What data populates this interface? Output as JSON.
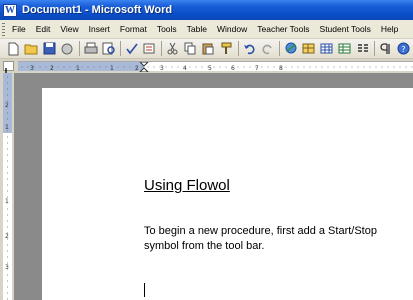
{
  "window": {
    "title": "Document1 - Microsoft Word",
    "app_icon": "W"
  },
  "menubar": {
    "items": [
      {
        "label": "File"
      },
      {
        "label": "Edit"
      },
      {
        "label": "View"
      },
      {
        "label": "Insert"
      },
      {
        "label": "Format"
      },
      {
        "label": "Tools"
      },
      {
        "label": "Table"
      },
      {
        "label": "Window"
      },
      {
        "label": "Teacher Tools"
      },
      {
        "label": "Student Tools"
      },
      {
        "label": "Help"
      }
    ]
  },
  "toolbar": {
    "icons": [
      "new-document-icon",
      "open-folder-icon",
      "save-icon",
      "permission-icon",
      "print-icon",
      "print-preview-icon",
      "spelling-icon",
      "research-icon",
      "cut-icon",
      "copy-icon",
      "paste-icon",
      "format-painter-icon",
      "undo-icon",
      "redo-icon",
      "hyperlink-icon",
      "tables-borders-icon",
      "insert-table-icon",
      "insert-excel-icon",
      "columns-icon",
      "show-hide-icon",
      "help-icon"
    ]
  },
  "ruler": {
    "horizontal_numbers": [
      "3",
      "2",
      "1",
      "1",
      "2",
      "3",
      "4",
      "5",
      "6",
      "7",
      "8"
    ],
    "vertical_numbers": [
      "2",
      "1",
      "1",
      "2",
      "3"
    ]
  },
  "document": {
    "title": "Using Flowol",
    "paragraph": "To begin a new procedure, first add a Start/Stop symbol from the tool bar."
  },
  "colors": {
    "titlebar": "#0b4ec9",
    "chrome": "#ece9d8",
    "workspace": "#8a8a8a",
    "ruler_margin": "#a9b9d8"
  }
}
